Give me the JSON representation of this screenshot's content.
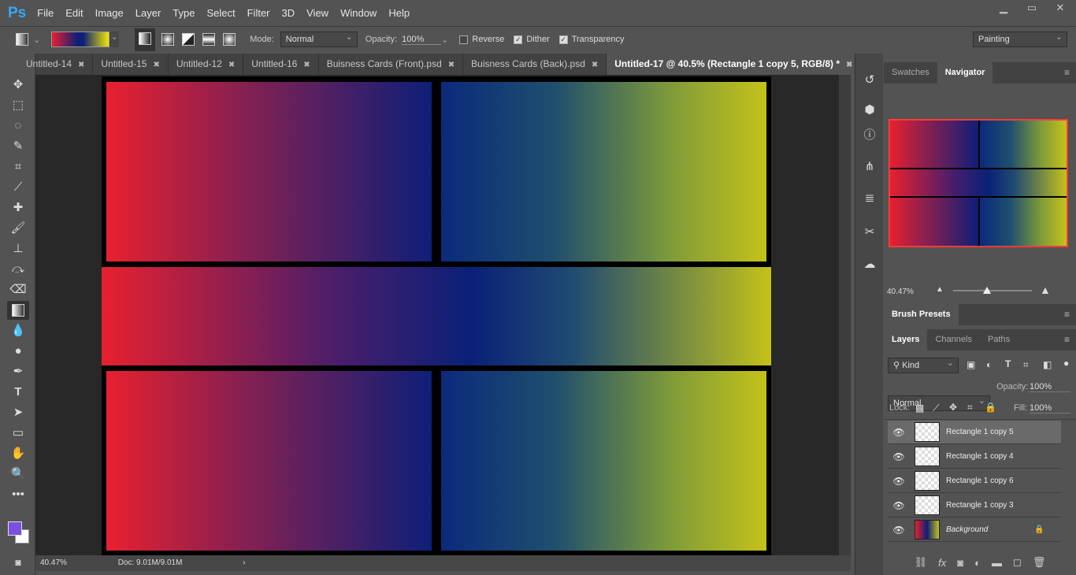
{
  "app": {
    "logo": "Ps",
    "menu": [
      "File",
      "Edit",
      "Image",
      "Layer",
      "Type",
      "Select",
      "Filter",
      "3D",
      "View",
      "Window",
      "Help"
    ],
    "window_controls": [
      "minimize",
      "restore",
      "close"
    ]
  },
  "options": {
    "mode_label": "Mode:",
    "mode_value": "Normal",
    "opacity_label": "Opacity:",
    "opacity_value": "100%",
    "reverse_label": "Reverse",
    "reverse_checked": false,
    "dither_label": "Dither",
    "dither_checked": true,
    "transparency_label": "Transparency",
    "transparency_checked": true,
    "workspace": "Painting",
    "gradient_colors": [
      "#e8202f",
      "#0e1f78",
      "#f0e800"
    ]
  },
  "tabs": [
    {
      "label": "Untitled-14",
      "active": false
    },
    {
      "label": "Untitled-15",
      "active": false
    },
    {
      "label": "Untitled-12",
      "active": false
    },
    {
      "label": "Untitled-16",
      "active": false
    },
    {
      "label": "Buisness Cards (Front).psd",
      "active": false
    },
    {
      "label": "Buisness Cards (Back).psd",
      "active": false
    },
    {
      "label": "Untitled-17 @ 40.5% (Rectangle 1 copy 5, RGB/8) *",
      "active": true
    }
  ],
  "tools": [
    "move",
    "marquee",
    "lasso",
    "quick-select",
    "crop",
    "eyedropper",
    "healing",
    "brush",
    "stamp",
    "history-brush",
    "eraser",
    "gradient",
    "blur",
    "dodge",
    "pen",
    "type",
    "path-select",
    "rectangle",
    "hand",
    "zoom",
    "more"
  ],
  "colors": {
    "foreground": "#7b4fe0",
    "background": "#ffffff"
  },
  "status": {
    "zoom": "40.47%",
    "doc": "Doc: 9.01M/9.01M"
  },
  "navigator": {
    "tabs": [
      "Swatches",
      "Navigator"
    ],
    "active": "Navigator",
    "zoom": "40.47%",
    "zoom_slider": 0.3
  },
  "brush_presets": {
    "title": "Brush Presets"
  },
  "layers_panel": {
    "tabs": [
      "Layers",
      "Channels",
      "Paths"
    ],
    "active": "Layers",
    "filter": "Kind",
    "blend": "Normal",
    "opacity_label": "Opacity:",
    "opacity": "100%",
    "lock_label": "Lock:",
    "fill_label": "Fill:",
    "fill": "100%",
    "layers": [
      {
        "name": "Rectangle 1 copy 5",
        "selected": true
      },
      {
        "name": "Rectangle 1 copy 4",
        "selected": false
      },
      {
        "name": "Rectangle 1 copy 6",
        "selected": false
      },
      {
        "name": "Rectangle 1 copy 3",
        "selected": false
      },
      {
        "name": "Background",
        "selected": false,
        "locked": true
      }
    ]
  }
}
